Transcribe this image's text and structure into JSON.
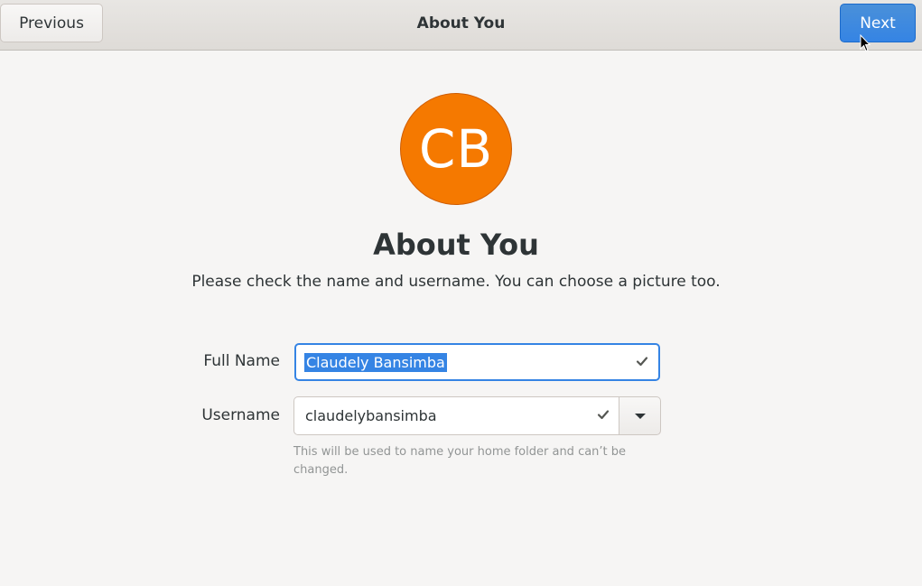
{
  "header": {
    "previous_label": "Previous",
    "title": "About You",
    "next_label": "Next"
  },
  "avatar": {
    "initials": "CB",
    "color": "#f57900"
  },
  "main": {
    "heading": "About You",
    "subtitle": "Please check the name and username. You can choose a picture too."
  },
  "form": {
    "full_name_label": "Full Name",
    "full_name_value": "Claudely Bansimba",
    "username_label": "Username",
    "username_value": "claudelybansimba",
    "hint": "This will be used to name your home folder and can’t be changed.",
    "check_icon": "checkmark-icon",
    "dropdown_icon": "chevron-down-icon"
  },
  "colors": {
    "accent": "#3584e4",
    "background": "#f6f5f4"
  }
}
